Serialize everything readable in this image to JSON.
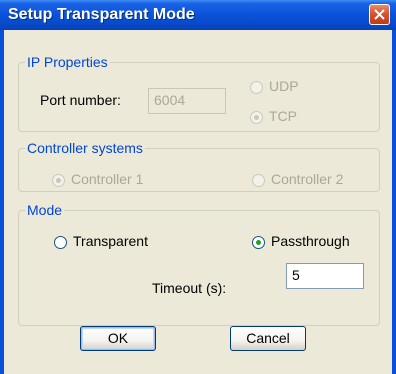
{
  "window": {
    "title": "Setup Transparent Mode"
  },
  "ip_properties": {
    "legend": "IP Properties",
    "port_label": "Port number:",
    "port_value": "6004",
    "udp_label": "UDP",
    "tcp_label": "TCP",
    "selected": "TCP"
  },
  "controller_systems": {
    "legend": "Controller systems",
    "controller1_label": "Controller 1",
    "controller2_label": "Controller 2",
    "selected": "Controller 1"
  },
  "mode": {
    "legend": "Mode",
    "transparent_label": "Transparent",
    "passthrough_label": "Passthrough",
    "selected": "Passthrough",
    "timeout_label": "Timeout (s):",
    "timeout_value": "5"
  },
  "buttons": {
    "ok_label": "OK",
    "cancel_label": "Cancel"
  },
  "colors": {
    "title_bar": "#0a52d9",
    "dialog_bg": "#ece9d8",
    "close_button": "#d9532b",
    "group_label": "#0046d5"
  }
}
